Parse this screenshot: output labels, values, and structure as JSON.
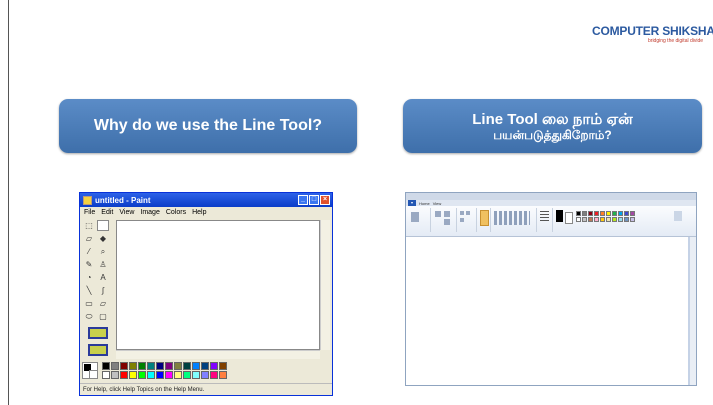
{
  "logo": {
    "name": "COMPUTER SHIKSHA",
    "tagline": "bridging the digital divide"
  },
  "heading_english": "Why do we use the Line Tool?",
  "heading_tamil": {
    "line1": "Line Tool லை நாம் ஏன்",
    "line2": "பயன்படுத்துகிறோம்?"
  },
  "paint_xp": {
    "title": "untitled - Paint",
    "menu": [
      "File",
      "Edit",
      "View",
      "Image",
      "Colors",
      "Help"
    ],
    "status": "For Help, click Help Topics on the Help Menu.",
    "palette_colors": [
      "#000000",
      "#808080",
      "#800000",
      "#808000",
      "#008000",
      "#008080",
      "#000080",
      "#800080",
      "#808040",
      "#004040",
      "#0080ff",
      "#004080",
      "#8000ff",
      "#804000",
      "#ffffff",
      "#c0c0c0",
      "#ff0000",
      "#ffff00",
      "#00ff00",
      "#00ffff",
      "#0000ff",
      "#ff00ff",
      "#ffff80",
      "#00ff80",
      "#80ffff",
      "#8080ff",
      "#ff0080",
      "#ff8040"
    ]
  },
  "paint_win7": {
    "tabs": [
      "Home",
      "View"
    ],
    "ribbon_colors": [
      "#000000",
      "#7f7f7f",
      "#880015",
      "#ed1c24",
      "#ff7f27",
      "#fff200",
      "#22b14c",
      "#00a2e8",
      "#3f48cc",
      "#a349a4",
      "#ffffff",
      "#c3c3c3",
      "#b97a57",
      "#ffaec9",
      "#ffc90e",
      "#efe4b0",
      "#b5e61d",
      "#99d9ea",
      "#7092be",
      "#c8bfe7"
    ]
  }
}
